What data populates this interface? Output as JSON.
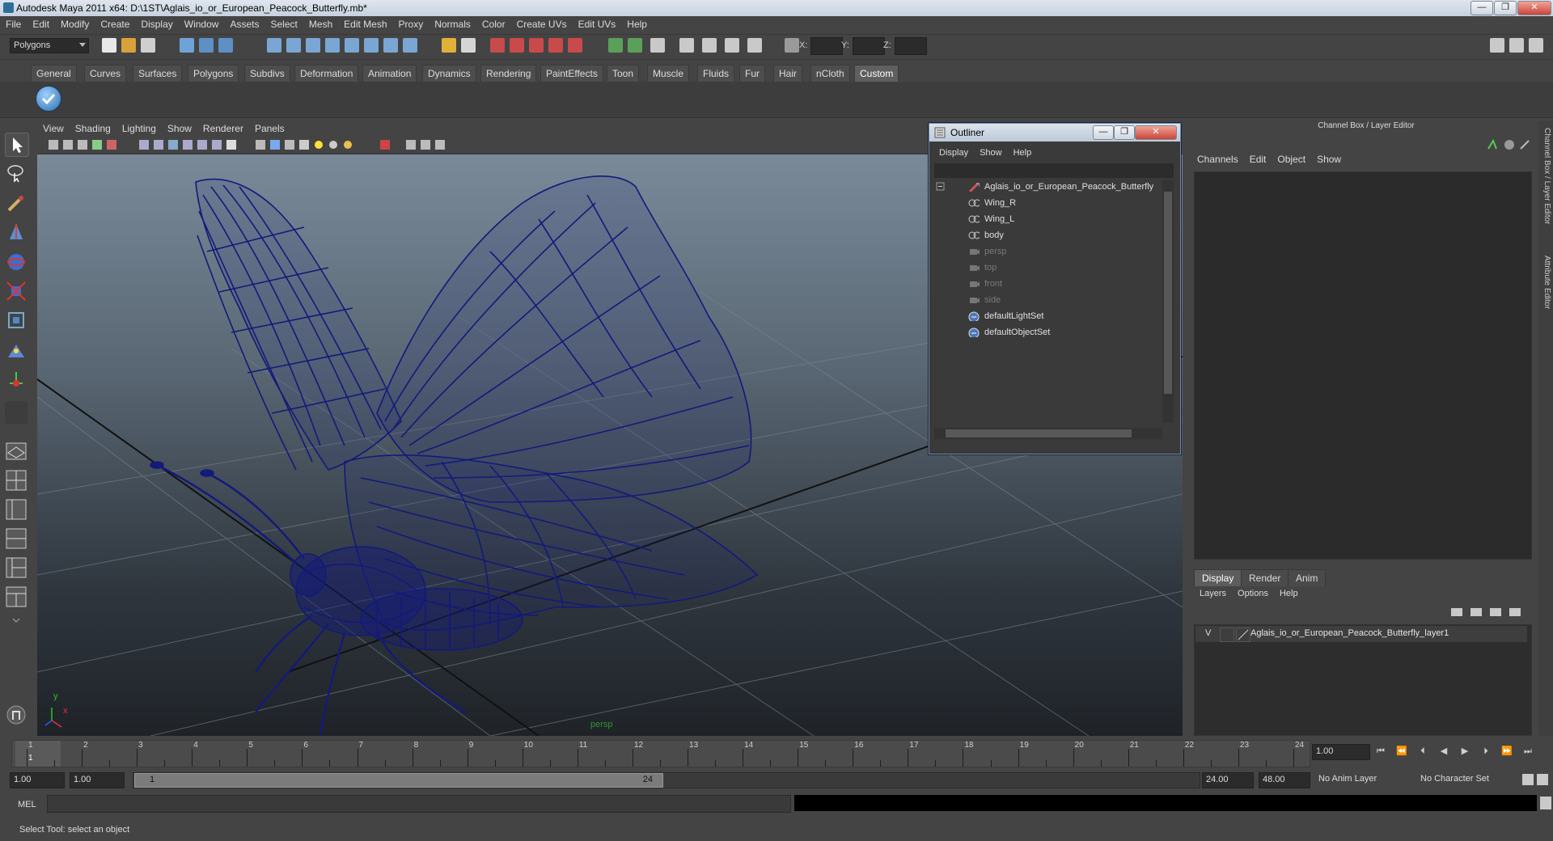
{
  "window": {
    "title": "Autodesk Maya 2011 x64: D:\\1ST\\Aglais_io_or_European_Peacock_Butterfly.mb*",
    "buttons": [
      "—",
      "❐",
      "✕"
    ]
  },
  "menubar": [
    "File",
    "Edit",
    "Modify",
    "Create",
    "Display",
    "Window",
    "Assets",
    "Select",
    "Mesh",
    "Edit Mesh",
    "Proxy",
    "Normals",
    "Color",
    "Create UVs",
    "Edit UVs",
    "Help"
  ],
  "statusline": {
    "mode": "Polygons",
    "x_label": "X:",
    "y_label": "Y:",
    "z_label": "Z:"
  },
  "shelf": {
    "tabs": [
      "General",
      "Curves",
      "Surfaces",
      "Polygons",
      "Subdivs",
      "Deformation",
      "Animation",
      "Dynamics",
      "Rendering",
      "PaintEffects",
      "Toon",
      "Muscle",
      "Fluids",
      "Fur",
      "Hair",
      "nCloth",
      "Custom"
    ],
    "active": "Custom"
  },
  "viewport": {
    "menu": [
      "View",
      "Shading",
      "Lighting",
      "Show",
      "Renderer",
      "Panels"
    ],
    "camera_label": "persp",
    "axis_y": "y",
    "axis_x": "x",
    "wire_color": "#121a78"
  },
  "outliner": {
    "title": "Outliner",
    "menu": [
      "Display",
      "Show",
      "Help"
    ],
    "items": [
      {
        "label": "Aglais_io_or_European_Peacock_Butterfly",
        "dim": false
      },
      {
        "label": "Wing_R",
        "dim": false
      },
      {
        "label": "Wing_L",
        "dim": false
      },
      {
        "label": "body",
        "dim": false
      },
      {
        "label": "persp",
        "dim": true
      },
      {
        "label": "top",
        "dim": true
      },
      {
        "label": "front",
        "dim": true
      },
      {
        "label": "side",
        "dim": true
      },
      {
        "label": "defaultLightSet",
        "dim": false
      },
      {
        "label": "defaultObjectSet",
        "dim": false
      }
    ]
  },
  "channelbox": {
    "title": "Channel Box / Layer Editor",
    "menu": [
      "Channels",
      "Edit",
      "Object",
      "Show"
    ],
    "layer_tabs": [
      "Display",
      "Render",
      "Anim"
    ],
    "layer_menu": [
      "Layers",
      "Options",
      "Help"
    ],
    "layer": {
      "visible": "V",
      "name": "Aglais_io_or_European_Peacock_Butterfly_layer1"
    }
  },
  "side_tabs": [
    "Channel Box / Layer Editor",
    "Attribute Editor"
  ],
  "timeline": {
    "ticks": [
      "1",
      "2",
      "3",
      "4",
      "5",
      "6",
      "7",
      "8",
      "9",
      "10",
      "11",
      "12",
      "13",
      "14",
      "15",
      "16",
      "17",
      "18",
      "19",
      "20",
      "21",
      "22",
      "23",
      "24"
    ],
    "current_frame_marker": "1",
    "current_frame": "1.00"
  },
  "range": {
    "start": "1.00",
    "playback_start": "1.00",
    "handle_start": "1",
    "handle_end": "24",
    "playback_end": "24.00",
    "end": "48.00",
    "anim_layer": "No Anim Layer",
    "character_set": "No Character Set"
  },
  "cmdline": {
    "label": "MEL"
  },
  "helpline": {
    "text": "Select Tool: select an object"
  }
}
